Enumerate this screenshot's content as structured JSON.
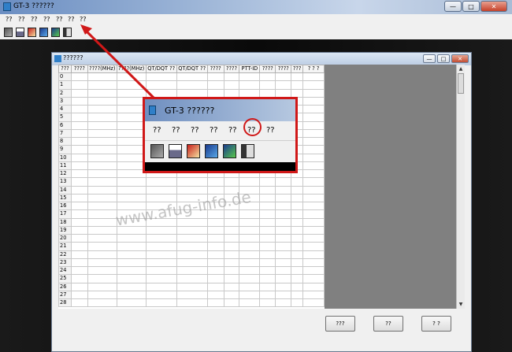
{
  "app": {
    "title": "GT-3 ??????"
  },
  "menu": {
    "items": [
      "??",
      "??",
      "??",
      "??",
      "??",
      "??",
      "??"
    ]
  },
  "toolbar": {
    "icons": [
      "copy-icon",
      "save-icon",
      "edit-icon",
      "read-radio-icon",
      "write-radio-icon",
      "exit-icon"
    ]
  },
  "child": {
    "title": "??????",
    "columns": [
      "???",
      "????",
      "????(MHz)",
      "????(MHz)",
      "QT/DQT ??",
      "QT/DQT ??",
      "????",
      "????",
      "PTT-ID",
      "????",
      "????",
      "???",
      "? ? ?"
    ],
    "row_numbers": [
      0,
      1,
      2,
      3,
      4,
      5,
      6,
      7,
      8,
      9,
      10,
      11,
      12,
      13,
      14,
      15,
      16,
      17,
      18,
      19,
      20,
      21,
      22,
      23,
      24,
      25,
      26,
      27,
      28
    ],
    "buttons": {
      "b1": "???",
      "b2": "??",
      "b3": "? ?"
    }
  },
  "inset": {
    "title": "GT-3 ??????",
    "menu": [
      "??",
      "??",
      "??",
      "??",
      "??",
      "??",
      "??"
    ],
    "highlight_color": "#d01818"
  },
  "watermark": "www.afug-info.de"
}
